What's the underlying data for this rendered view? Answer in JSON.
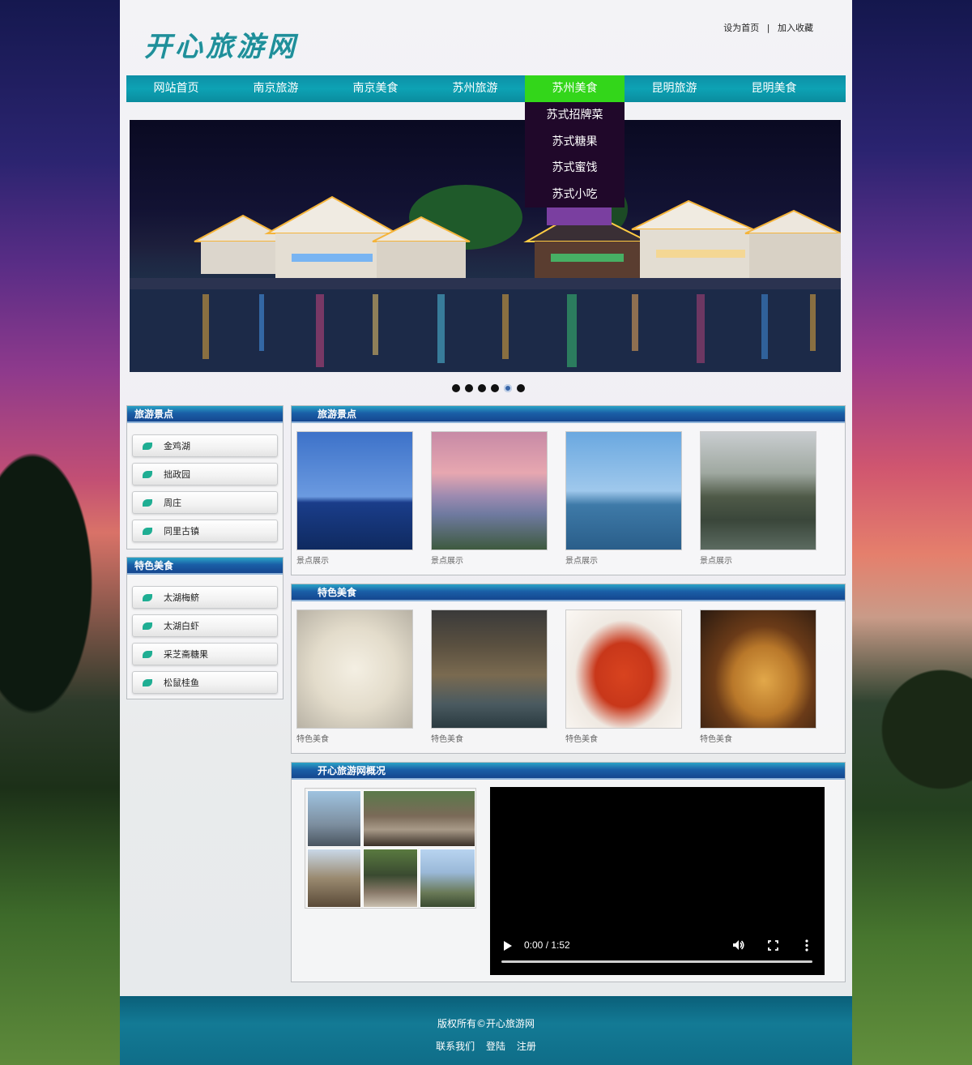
{
  "site": {
    "logo": "开心旅游网",
    "top_links": [
      "设为首页",
      "|",
      "加入收藏"
    ]
  },
  "nav": {
    "items": [
      "网站首页",
      "南京旅游",
      "南京美食",
      "苏州旅游",
      "苏州美食",
      "昆明旅游",
      "昆明美食"
    ],
    "active": "苏州美食",
    "dropdown": [
      "苏式招牌菜",
      "苏式糖果",
      "苏式蜜饯",
      "苏式小吃"
    ]
  },
  "colors": {
    "nav_bg": "#0da2b4",
    "nav_active": "#33d61a",
    "dropdown_bg": "#20082a",
    "title_bar": "#1a5fa7",
    "footer_bg": "#137a95",
    "leaf_icon": "#1fae93"
  },
  "slider": {
    "dot_count": 6,
    "active_dot": 5
  },
  "sidebar": {
    "sights": {
      "title": "旅游景点",
      "items": [
        "金鸡湖",
        "拙政园",
        "周庄",
        "同里古镇"
      ]
    },
    "food": {
      "title": "特色美食",
      "items": [
        "太湖梅鲚",
        "太湖白虾",
        "采芝斋糖果",
        "松鼠桂鱼"
      ]
    }
  },
  "main": {
    "sights": {
      "title": "旅游景点",
      "captions": [
        "景点展示",
        "景点展示",
        "景点展示",
        "景点展示"
      ]
    },
    "food": {
      "title": "特色美食",
      "captions": [
        "特色美食",
        "特色美食",
        "特色美食",
        "特色美食"
      ]
    },
    "overview": {
      "title": "开心旅游网概况",
      "video_time": "0:00 / 1:52"
    }
  },
  "footer": {
    "copyright": "版权所有©开心旅游网",
    "links": [
      "联系我们",
      "登陆",
      "注册"
    ]
  }
}
